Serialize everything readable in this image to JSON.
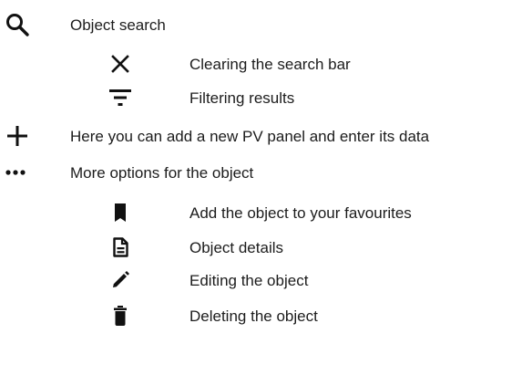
{
  "items": [
    {
      "icon": "search-icon",
      "label": "Object search"
    },
    {
      "icon": "close-icon",
      "label": "Clearing the search bar"
    },
    {
      "icon": "filter-icon",
      "label": "Filtering results"
    },
    {
      "icon": "plus-icon",
      "label": "Here you can add a new PV panel and enter its data"
    },
    {
      "icon": "more-horizontal-icon",
      "label": "More options for the object"
    },
    {
      "icon": "bookmark-icon",
      "label": "Add the object to your favourites"
    },
    {
      "icon": "document-icon",
      "label": "Object details"
    },
    {
      "icon": "pencil-icon",
      "label": "Editing the object"
    },
    {
      "icon": "trash-icon",
      "label": "Deleting the object"
    }
  ],
  "colors": {
    "text": "#1c1c1c",
    "icon": "#111111"
  }
}
